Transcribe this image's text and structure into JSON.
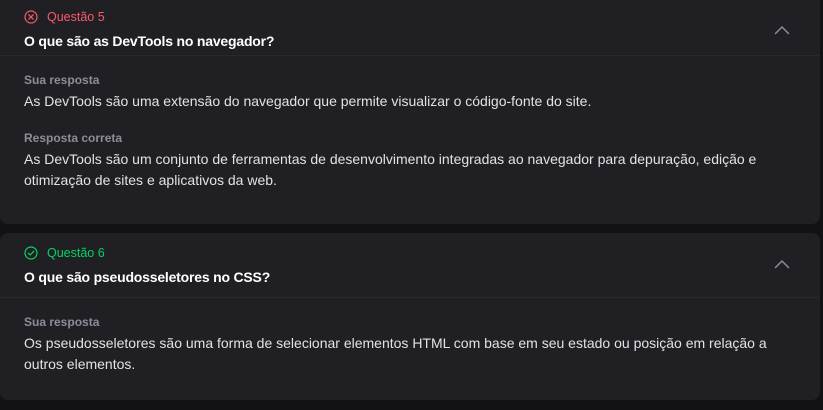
{
  "questions": [
    {
      "status_label": "Questão 5",
      "result": "wrong",
      "title": "O que são as DevTools no navegador?",
      "your_answer_label": "Sua resposta",
      "your_answer": "As DevTools são uma extensão do navegador que permite visualizar o código-fonte do site.",
      "correct_answer_label": "Resposta correta",
      "correct_answer": "As DevTools são um conjunto de ferramentas de desenvolvimento integradas ao navegador para depuração, edição e otimização de sites e aplicativos da web."
    },
    {
      "status_label": "Questão 6",
      "result": "correct",
      "title": "O que são pseudosseletores no CSS?",
      "your_answer_label": "Sua resposta",
      "your_answer": "Os pseudosseletores são uma forma de selecionar elementos HTML com base em seu estado ou posição em relação a outros elementos."
    }
  ],
  "colors": {
    "wrong": "#f75a68",
    "correct": "#04d361",
    "card_bg": "#202024",
    "page_bg": "#121214"
  },
  "icons": {
    "wrong": "x-circle-icon",
    "correct": "check-circle-icon",
    "collapse": "chevron-up-icon"
  }
}
